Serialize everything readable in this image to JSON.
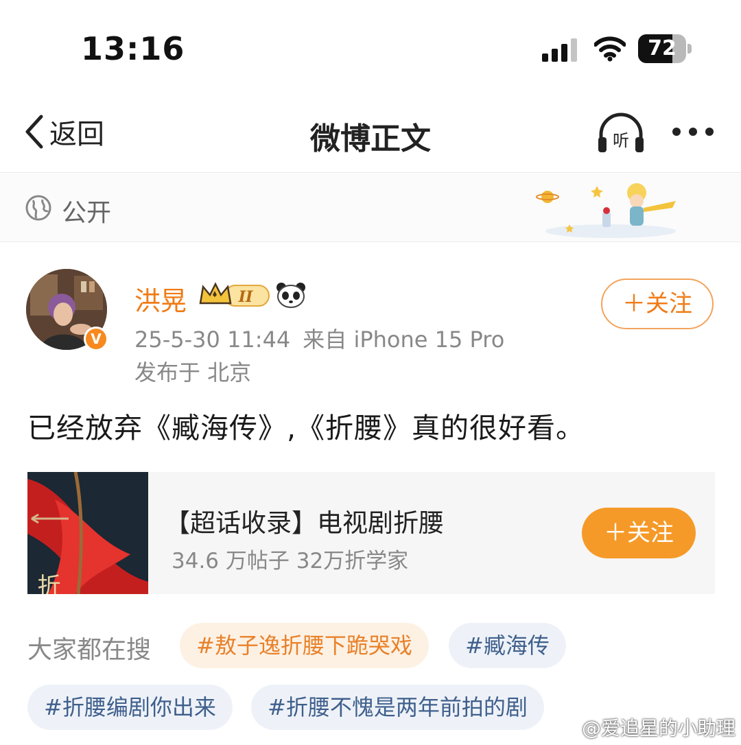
{
  "status_bar": {
    "time": "13:16",
    "battery": "72",
    "battery_level": 0.72
  },
  "nav": {
    "back_label": "返回",
    "title": "微博正文",
    "listen_label": "听"
  },
  "visibility": {
    "label": "公开"
  },
  "author": {
    "name": "洪晃",
    "level_badge": "II",
    "verified_mark": "V",
    "timestamp": "25-5-30 11:44",
    "source": "来自 iPhone 15 Pro",
    "location": "发布于 北京",
    "follow_label": "＋关注"
  },
  "post": {
    "text": "已经放弃《臧海传》,《折腰》真的很好看。"
  },
  "supertopic_card": {
    "title": "【超话收录】电视剧折腰",
    "stats": "34.6 万帖子  32万折学家",
    "follow_label": "＋关注",
    "cover_text": "折腰"
  },
  "hot_searches": {
    "label": "大家都在搜",
    "tags": [
      {
        "text": "#敖子逸折腰下跪哭戏",
        "style": "hot"
      },
      {
        "text": "#臧海传",
        "style": "normal"
      },
      {
        "text": "#折腰编剧你出来",
        "style": "normal"
      },
      {
        "text": "#折腰不愧是两年前拍的剧",
        "style": "normal"
      }
    ]
  },
  "watermark": {
    "text": "@爱追星的小助理"
  },
  "colors": {
    "accent_orange": "#f07b16",
    "button_orange": "#f59a28",
    "tag_blue": "#3f5f8c"
  }
}
